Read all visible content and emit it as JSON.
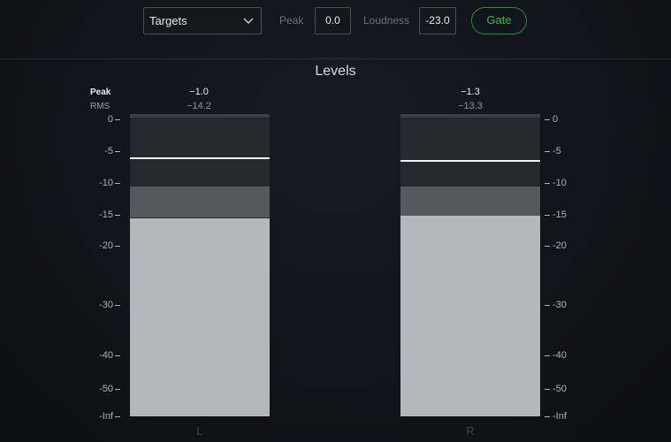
{
  "toolbar": {
    "mode_select": "Targets",
    "peak_label": "Peak",
    "peak_value": "0.0",
    "loudness_label": "Loudness",
    "loudness_value": "-23.0",
    "gate_label": "Gate",
    "gate_color": "#3bb54a"
  },
  "panel": {
    "title": "Levels",
    "legend_peak": "Peak",
    "legend_rms": "RMS"
  },
  "channels": [
    {
      "label": "L",
      "peak": "−1.0",
      "rms": "−14.2",
      "peak_db": -6.0,
      "rms_db": -15.5,
      "rms_hold_db": -10.5
    },
    {
      "label": "R",
      "peak": "−1.3",
      "rms": "−13.3",
      "peak_db": -6.4,
      "rms_db": -15.2,
      "rms_hold_db": -10.5
    }
  ],
  "scale": {
    "ticks": [
      "0",
      "-5",
      "-10",
      "-15",
      "-20",
      "-30",
      "-40",
      "-50",
      "-Inf"
    ],
    "tick_db": [
      0,
      -5,
      -10,
      -15,
      -20,
      -30,
      -40,
      -50,
      -60
    ]
  },
  "colors": {
    "meter_bg": "#25282d",
    "rms_fill": "#b4b8bd",
    "rms_hold": "#55585d",
    "peak_line": "#f2f3f5"
  }
}
